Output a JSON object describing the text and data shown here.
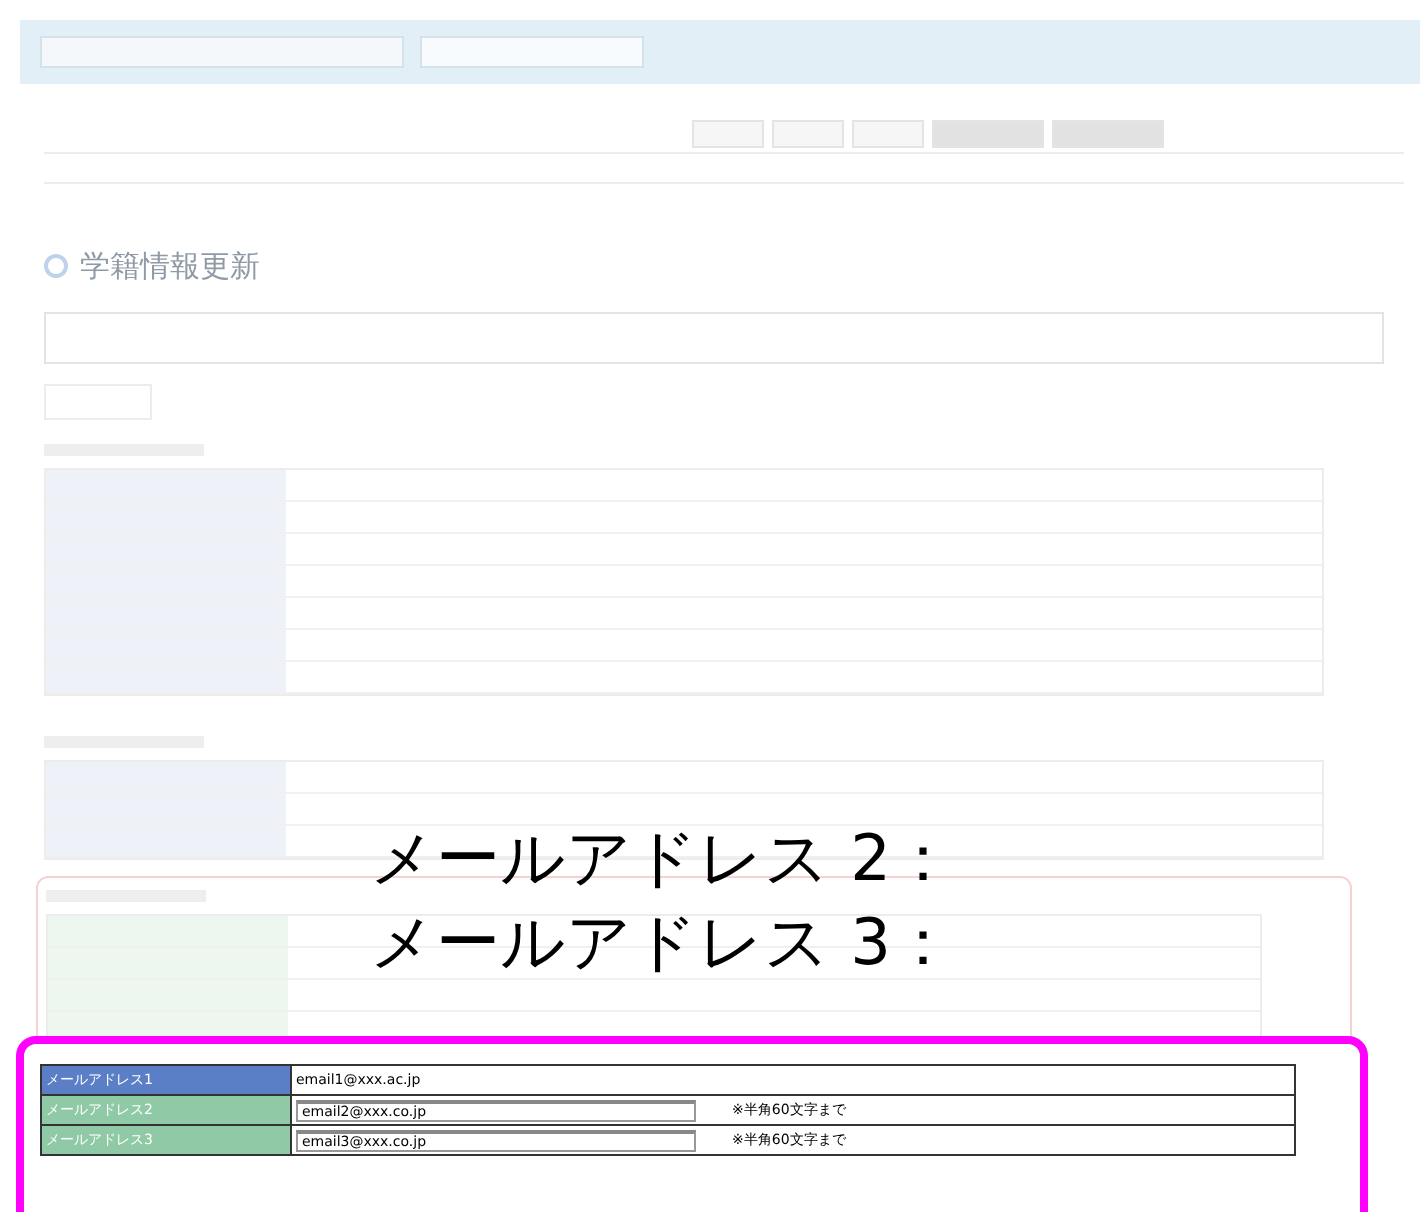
{
  "page": {
    "title": "学籍情報更新"
  },
  "overlay": {
    "lines": [
      "メールアドレス 2：",
      "メールアドレス 3："
    ]
  },
  "email_table": {
    "rows": [
      {
        "kind": "display",
        "label": "メールアドレス1",
        "value": "email1@xxx.ac.jp"
      },
      {
        "kind": "input",
        "label": "メールアドレス2",
        "value": "email2@xxx.co.jp",
        "note": "※半角60文字まで"
      },
      {
        "kind": "input",
        "label": "メールアドレス3",
        "value": "email3@xxx.co.jp",
        "note": "※半角60文字まで"
      }
    ]
  }
}
